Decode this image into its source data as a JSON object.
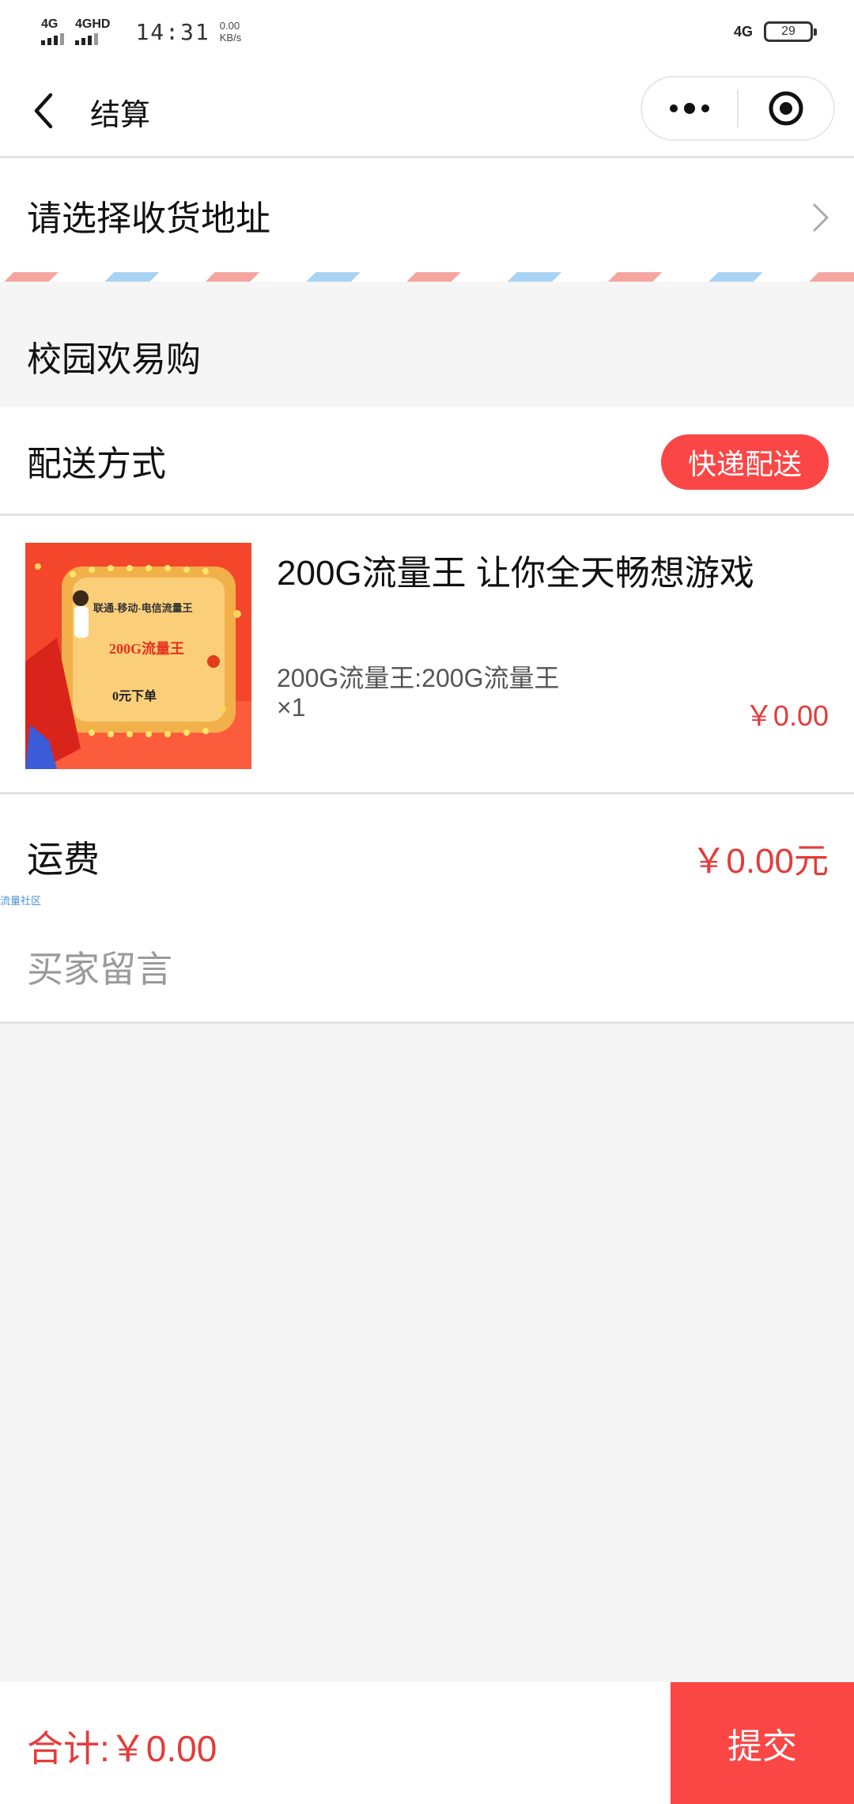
{
  "status_bar": {
    "signal1": "4G",
    "signal2": "4GHD",
    "time": "14:31",
    "net_speed_value": "0.00",
    "net_speed_unit": "KB/s",
    "network": "4G",
    "battery": "29"
  },
  "header": {
    "title": "结算"
  },
  "address": {
    "label": "请选择收货地址"
  },
  "store": {
    "name": "校园欢易购"
  },
  "delivery": {
    "label": "配送方式",
    "method": "快递配送"
  },
  "product": {
    "image_text1": "联通-移动-电信流量王",
    "image_text2": "200G流量王",
    "image_text3": "0元下单",
    "title": "200G流量王 让你全天畅想游戏",
    "spec": "200G流量王:200G流量王",
    "quantity": "×1",
    "price": "￥0.00"
  },
  "shipping": {
    "label": "运费",
    "value": "￥0.00元"
  },
  "watermark": "流量社区",
  "message": {
    "placeholder": "买家留言",
    "value": ""
  },
  "footer": {
    "total": "合计:￥0.00",
    "submit_label": "提交"
  },
  "colors": {
    "accent": "#fb4646",
    "price": "#e53b3b"
  }
}
